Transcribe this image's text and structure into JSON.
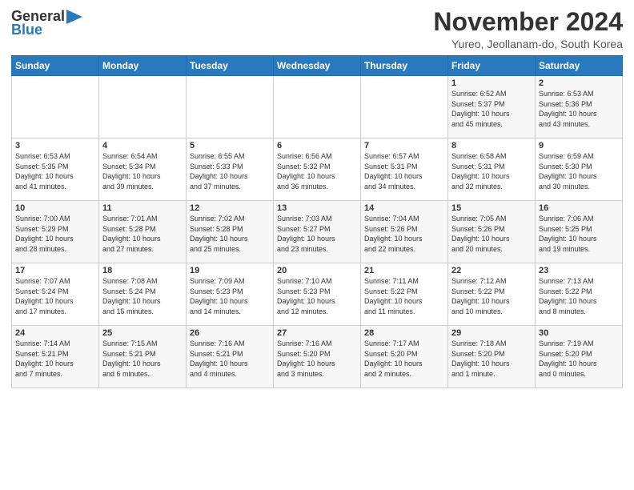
{
  "header": {
    "logo_line1": "General",
    "logo_line2": "Blue",
    "month": "November 2024",
    "location": "Yureo, Jeollanam-do, South Korea"
  },
  "weekdays": [
    "Sunday",
    "Monday",
    "Tuesday",
    "Wednesday",
    "Thursday",
    "Friday",
    "Saturday"
  ],
  "weeks": [
    [
      {
        "day": "",
        "info": ""
      },
      {
        "day": "",
        "info": ""
      },
      {
        "day": "",
        "info": ""
      },
      {
        "day": "",
        "info": ""
      },
      {
        "day": "",
        "info": ""
      },
      {
        "day": "1",
        "info": "Sunrise: 6:52 AM\nSunset: 5:37 PM\nDaylight: 10 hours\nand 45 minutes."
      },
      {
        "day": "2",
        "info": "Sunrise: 6:53 AM\nSunset: 5:36 PM\nDaylight: 10 hours\nand 43 minutes."
      }
    ],
    [
      {
        "day": "3",
        "info": "Sunrise: 6:53 AM\nSunset: 5:35 PM\nDaylight: 10 hours\nand 41 minutes."
      },
      {
        "day": "4",
        "info": "Sunrise: 6:54 AM\nSunset: 5:34 PM\nDaylight: 10 hours\nand 39 minutes."
      },
      {
        "day": "5",
        "info": "Sunrise: 6:55 AM\nSunset: 5:33 PM\nDaylight: 10 hours\nand 37 minutes."
      },
      {
        "day": "6",
        "info": "Sunrise: 6:56 AM\nSunset: 5:32 PM\nDaylight: 10 hours\nand 36 minutes."
      },
      {
        "day": "7",
        "info": "Sunrise: 6:57 AM\nSunset: 5:31 PM\nDaylight: 10 hours\nand 34 minutes."
      },
      {
        "day": "8",
        "info": "Sunrise: 6:58 AM\nSunset: 5:31 PM\nDaylight: 10 hours\nand 32 minutes."
      },
      {
        "day": "9",
        "info": "Sunrise: 6:59 AM\nSunset: 5:30 PM\nDaylight: 10 hours\nand 30 minutes."
      }
    ],
    [
      {
        "day": "10",
        "info": "Sunrise: 7:00 AM\nSunset: 5:29 PM\nDaylight: 10 hours\nand 28 minutes."
      },
      {
        "day": "11",
        "info": "Sunrise: 7:01 AM\nSunset: 5:28 PM\nDaylight: 10 hours\nand 27 minutes."
      },
      {
        "day": "12",
        "info": "Sunrise: 7:02 AM\nSunset: 5:28 PM\nDaylight: 10 hours\nand 25 minutes."
      },
      {
        "day": "13",
        "info": "Sunrise: 7:03 AM\nSunset: 5:27 PM\nDaylight: 10 hours\nand 23 minutes."
      },
      {
        "day": "14",
        "info": "Sunrise: 7:04 AM\nSunset: 5:26 PM\nDaylight: 10 hours\nand 22 minutes."
      },
      {
        "day": "15",
        "info": "Sunrise: 7:05 AM\nSunset: 5:26 PM\nDaylight: 10 hours\nand 20 minutes."
      },
      {
        "day": "16",
        "info": "Sunrise: 7:06 AM\nSunset: 5:25 PM\nDaylight: 10 hours\nand 19 minutes."
      }
    ],
    [
      {
        "day": "17",
        "info": "Sunrise: 7:07 AM\nSunset: 5:24 PM\nDaylight: 10 hours\nand 17 minutes."
      },
      {
        "day": "18",
        "info": "Sunrise: 7:08 AM\nSunset: 5:24 PM\nDaylight: 10 hours\nand 15 minutes."
      },
      {
        "day": "19",
        "info": "Sunrise: 7:09 AM\nSunset: 5:23 PM\nDaylight: 10 hours\nand 14 minutes."
      },
      {
        "day": "20",
        "info": "Sunrise: 7:10 AM\nSunset: 5:23 PM\nDaylight: 10 hours\nand 12 minutes."
      },
      {
        "day": "21",
        "info": "Sunrise: 7:11 AM\nSunset: 5:22 PM\nDaylight: 10 hours\nand 11 minutes."
      },
      {
        "day": "22",
        "info": "Sunrise: 7:12 AM\nSunset: 5:22 PM\nDaylight: 10 hours\nand 10 minutes."
      },
      {
        "day": "23",
        "info": "Sunrise: 7:13 AM\nSunset: 5:22 PM\nDaylight: 10 hours\nand 8 minutes."
      }
    ],
    [
      {
        "day": "24",
        "info": "Sunrise: 7:14 AM\nSunset: 5:21 PM\nDaylight: 10 hours\nand 7 minutes."
      },
      {
        "day": "25",
        "info": "Sunrise: 7:15 AM\nSunset: 5:21 PM\nDaylight: 10 hours\nand 6 minutes."
      },
      {
        "day": "26",
        "info": "Sunrise: 7:16 AM\nSunset: 5:21 PM\nDaylight: 10 hours\nand 4 minutes."
      },
      {
        "day": "27",
        "info": "Sunrise: 7:16 AM\nSunset: 5:20 PM\nDaylight: 10 hours\nand 3 minutes."
      },
      {
        "day": "28",
        "info": "Sunrise: 7:17 AM\nSunset: 5:20 PM\nDaylight: 10 hours\nand 2 minutes."
      },
      {
        "day": "29",
        "info": "Sunrise: 7:18 AM\nSunset: 5:20 PM\nDaylight: 10 hours\nand 1 minute."
      },
      {
        "day": "30",
        "info": "Sunrise: 7:19 AM\nSunset: 5:20 PM\nDaylight: 10 hours\nand 0 minutes."
      }
    ]
  ]
}
